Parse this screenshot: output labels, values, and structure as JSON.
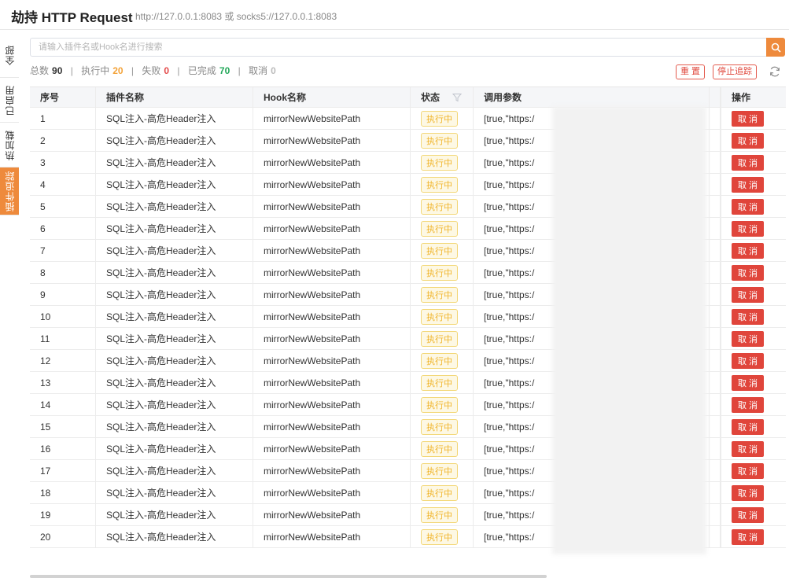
{
  "header": {
    "title": "劫持 HTTP Request",
    "proxy": "http://127.0.0.1:8083 或 socks5://127.0.0.1:8083"
  },
  "side_tabs": [
    "全部",
    "已启用",
    "热加载",
    "插件追踪"
  ],
  "search": {
    "placeholder": "请输入插件名或Hook名进行搜索",
    "icon": "search-icon"
  },
  "stats": {
    "total_label": "总数",
    "total": "90",
    "running_label": "执行中",
    "running": "20",
    "failed_label": "失败",
    "failed": "0",
    "done_label": "已完成",
    "done": "70",
    "cancel_label": "取消",
    "cancel": "0"
  },
  "actions": {
    "reset": "重 置",
    "stop": "停止追踪"
  },
  "columns": {
    "idx": "序号",
    "plugin": "插件名称",
    "hook": "Hook名称",
    "status": "状态",
    "params": "调用参数",
    "op": "操作"
  },
  "rows": [
    {
      "idx": "1",
      "plugin": "SQL注入-高危Header注入",
      "hook": "mirrorNewWebsitePath",
      "status": "执行中",
      "params": "[true,\"https:/",
      "op": "取 消"
    },
    {
      "idx": "2",
      "plugin": "SQL注入-高危Header注入",
      "hook": "mirrorNewWebsitePath",
      "status": "执行中",
      "params": "[true,\"https:/",
      "op": "取 消"
    },
    {
      "idx": "3",
      "plugin": "SQL注入-高危Header注入",
      "hook": "mirrorNewWebsitePath",
      "status": "执行中",
      "params": "[true,\"https:/",
      "op": "取 消"
    },
    {
      "idx": "4",
      "plugin": "SQL注入-高危Header注入",
      "hook": "mirrorNewWebsitePath",
      "status": "执行中",
      "params": "[true,\"https:/",
      "op": "取 消"
    },
    {
      "idx": "5",
      "plugin": "SQL注入-高危Header注入",
      "hook": "mirrorNewWebsitePath",
      "status": "执行中",
      "params": "[true,\"https:/",
      "op": "取 消"
    },
    {
      "idx": "6",
      "plugin": "SQL注入-高危Header注入",
      "hook": "mirrorNewWebsitePath",
      "status": "执行中",
      "params": "[true,\"https:/",
      "op": "取 消"
    },
    {
      "idx": "7",
      "plugin": "SQL注入-高危Header注入",
      "hook": "mirrorNewWebsitePath",
      "status": "执行中",
      "params": "[true,\"https:/",
      "op": "取 消"
    },
    {
      "idx": "8",
      "plugin": "SQL注入-高危Header注入",
      "hook": "mirrorNewWebsitePath",
      "status": "执行中",
      "params": "[true,\"https:/",
      "op": "取 消"
    },
    {
      "idx": "9",
      "plugin": "SQL注入-高危Header注入",
      "hook": "mirrorNewWebsitePath",
      "status": "执行中",
      "params": "[true,\"https:/",
      "op": "取 消"
    },
    {
      "idx": "10",
      "plugin": "SQL注入-高危Header注入",
      "hook": "mirrorNewWebsitePath",
      "status": "执行中",
      "params": "[true,\"https:/",
      "op": "取 消"
    },
    {
      "idx": "11",
      "plugin": "SQL注入-高危Header注入",
      "hook": "mirrorNewWebsitePath",
      "status": "执行中",
      "params": "[true,\"https:/",
      "op": "取 消"
    },
    {
      "idx": "12",
      "plugin": "SQL注入-高危Header注入",
      "hook": "mirrorNewWebsitePath",
      "status": "执行中",
      "params": "[true,\"https:/",
      "op": "取 消"
    },
    {
      "idx": "13",
      "plugin": "SQL注入-高危Header注入",
      "hook": "mirrorNewWebsitePath",
      "status": "执行中",
      "params": "[true,\"https:/",
      "op": "取 消"
    },
    {
      "idx": "14",
      "plugin": "SQL注入-高危Header注入",
      "hook": "mirrorNewWebsitePath",
      "status": "执行中",
      "params": "[true,\"https:/",
      "op": "取 消"
    },
    {
      "idx": "15",
      "plugin": "SQL注入-高危Header注入",
      "hook": "mirrorNewWebsitePath",
      "status": "执行中",
      "params": "[true,\"https:/",
      "op": "取 消"
    },
    {
      "idx": "16",
      "plugin": "SQL注入-高危Header注入",
      "hook": "mirrorNewWebsitePath",
      "status": "执行中",
      "params": "[true,\"https:/",
      "op": "取 消"
    },
    {
      "idx": "17",
      "plugin": "SQL注入-高危Header注入",
      "hook": "mirrorNewWebsitePath",
      "status": "执行中",
      "params": "[true,\"https:/",
      "op": "取 消"
    },
    {
      "idx": "18",
      "plugin": "SQL注入-高危Header注入",
      "hook": "mirrorNewWebsitePath",
      "status": "执行中",
      "params": "[true,\"https:/",
      "op": "取 消"
    },
    {
      "idx": "19",
      "plugin": "SQL注入-高危Header注入",
      "hook": "mirrorNewWebsitePath",
      "status": "执行中",
      "params": "[true,\"https:/",
      "op": "取 消"
    },
    {
      "idx": "20",
      "plugin": "SQL注入-高危Header注入",
      "hook": "mirrorNewWebsitePath",
      "status": "执行中",
      "params": "[true,\"https:/",
      "op": "取 消"
    }
  ],
  "colors": {
    "accent": "#ee8a3c",
    "running": "#f3a33a",
    "failed": "#e34949",
    "done": "#23a85a",
    "danger": "#e0453b"
  }
}
